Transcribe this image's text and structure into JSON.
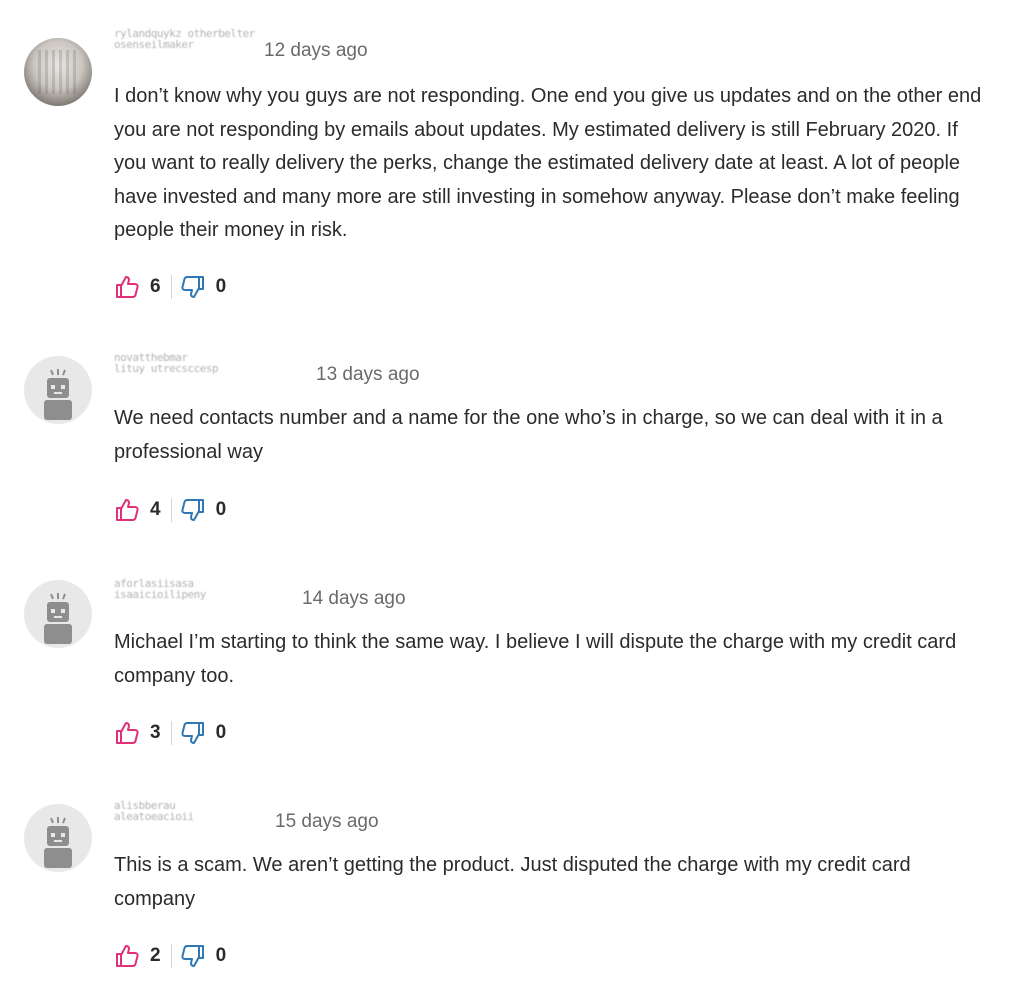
{
  "comments": [
    {
      "avatar": "user-photo",
      "username": "rylandquykz otherbelter",
      "username_line2": "osenseilmaker",
      "time": "12 days ago",
      "text": "I don’t know why you guys are not responding. One end you give us updates and on the other end you are not responding by emails about updates. My estimated delivery is still February 2020. If you want to really delivery the perks, change the estimated delivery date at least. A lot of people have invested and many more are still investing in somehow anyway. Please don’t make feeling people their money in risk.",
      "likes": "6",
      "dislikes": "0"
    },
    {
      "avatar": "robot-avatar",
      "username": "novatthebmar",
      "username_line2": "lituy utrecsccesp",
      "time": "13 days ago",
      "text": "We need contacts number and a name for the one who’s in charge, so we can deal with it in a professional way",
      "likes": "4",
      "dislikes": "0"
    },
    {
      "avatar": "robot-avatar",
      "username": "aforlasiisasa",
      "username_line2": "isaaicioilipeny",
      "time": "14 days ago",
      "text": "Michael I’m starting to think the same way. I believe I will dispute the charge with my credit card company too.",
      "likes": "3",
      "dislikes": "0"
    },
    {
      "avatar": "robot-avatar",
      "username": "alisbberau",
      "username_line2": "aleatoeacioii",
      "time": "15 days ago",
      "text": "This is a scam. We aren’t getting the product. Just disputed the charge with my credit card company",
      "likes": "2",
      "dislikes": "0"
    }
  ],
  "icons": {
    "like": "thumbs-up-icon",
    "dislike": "thumbs-down-icon",
    "like_color": "#e0307a",
    "dislike_color": "#2f77b5"
  }
}
